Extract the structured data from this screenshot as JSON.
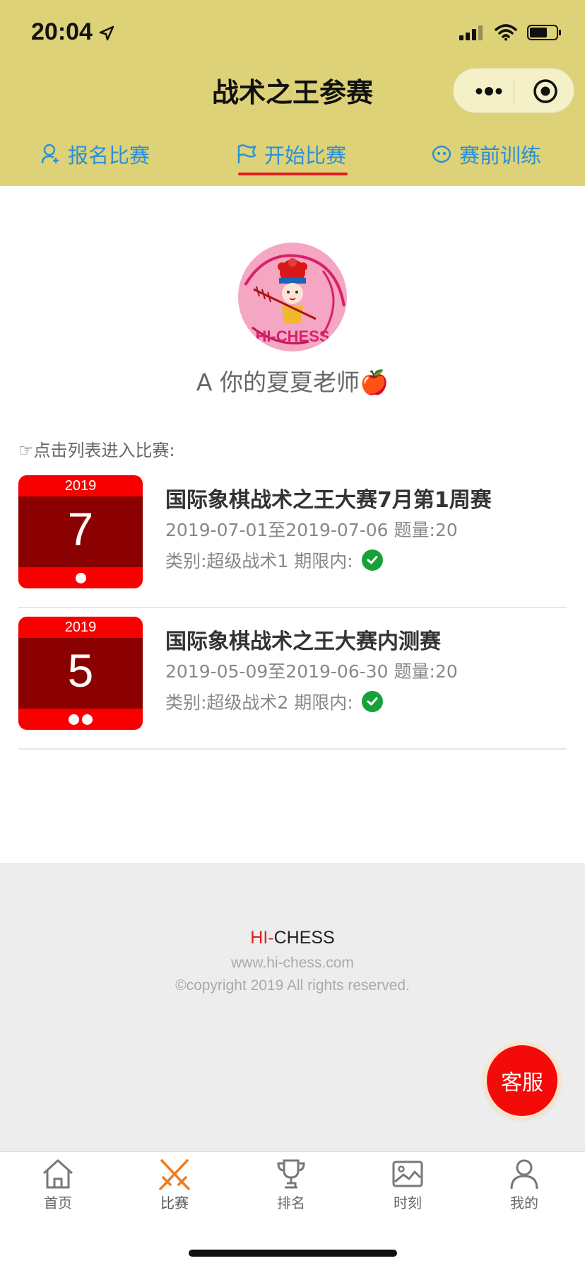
{
  "status_bar": {
    "time": "20:04"
  },
  "nav": {
    "title": "战术之王参赛"
  },
  "tabs": [
    {
      "label": "报名比赛",
      "icon": "user-add-icon"
    },
    {
      "label": "开始比赛",
      "icon": "flag-icon",
      "active": true
    },
    {
      "label": "赛前训练",
      "icon": "train-icon"
    }
  ],
  "profile": {
    "name": "A 你的夏夏老师🍎",
    "avatar_text": "HI-CHESS"
  },
  "list": {
    "hint": "☞点击列表进入比赛:",
    "matches": [
      {
        "year": "2019",
        "month": "7",
        "dots": 1,
        "title": "国际象棋战术之王大赛7月第1周赛",
        "dates": "2019-07-01至2019-07-06 题量:20",
        "category": "类别:超级战术1 期限内:"
      },
      {
        "year": "2019",
        "month": "5",
        "dots": 2,
        "title": "国际象棋战术之王大赛内测赛",
        "dates": "2019-05-09至2019-06-30 题量:20",
        "category": "类别:超级战术2 期限内:"
      }
    ]
  },
  "footer": {
    "brand_hi": "HI-",
    "brand_chess": "CHESS",
    "site": "www.hi-chess.com",
    "copyright": "©copyright 2019 All rights reserved."
  },
  "service_button": "客服",
  "tabbar": [
    {
      "label": "首页",
      "icon": "home-icon"
    },
    {
      "label": "比赛",
      "icon": "swords-icon",
      "active": true
    },
    {
      "label": "排名",
      "icon": "trophy-icon"
    },
    {
      "label": "时刻",
      "icon": "photo-icon"
    },
    {
      "label": "我的",
      "icon": "profile-icon"
    }
  ],
  "colors": {
    "header_bg": "#ddd277",
    "accent_red": "#f90000",
    "calendar_dark": "#8b0000",
    "tab_blue": "#2a8fd8",
    "active_orange": "#f07c1e",
    "check_green": "#17a13a"
  }
}
